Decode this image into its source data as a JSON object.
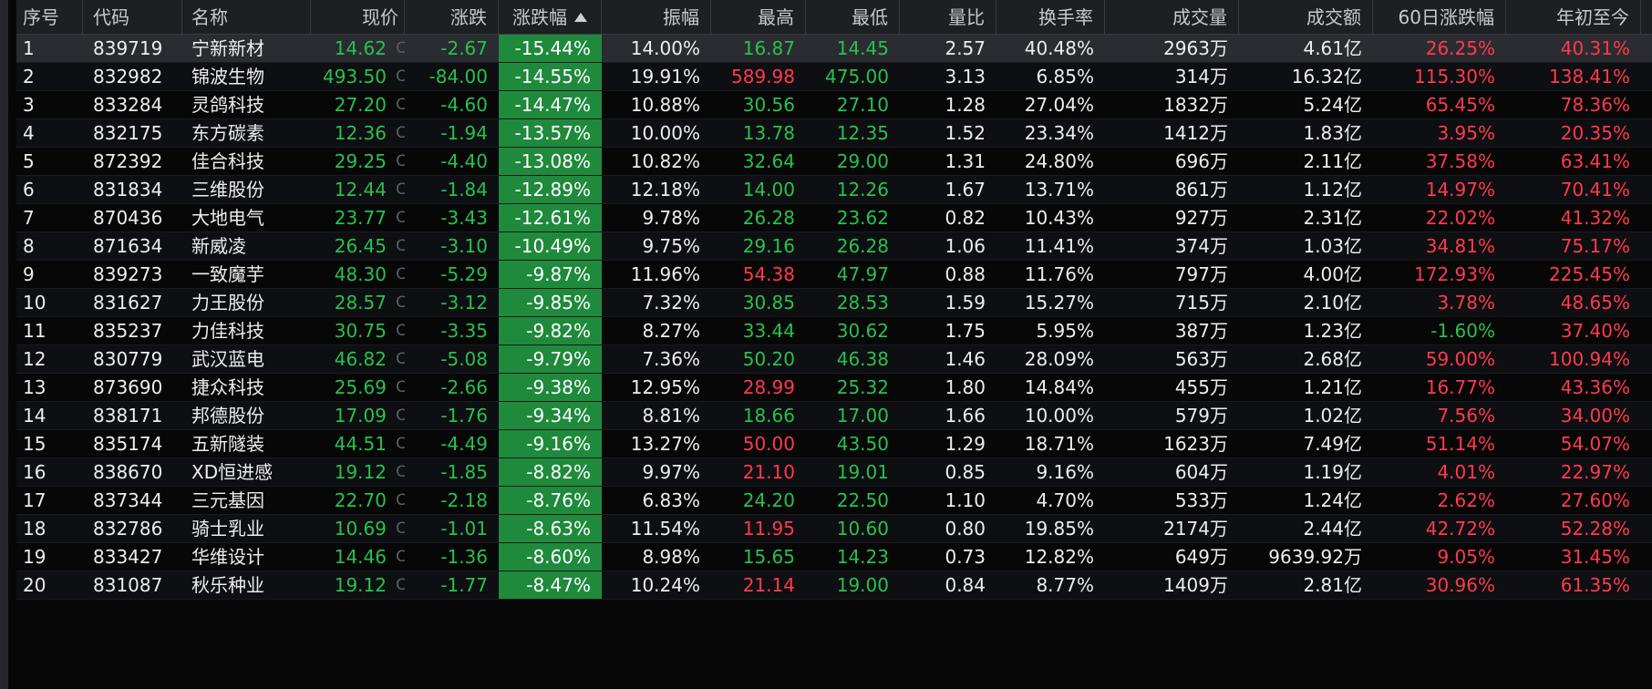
{
  "colors": {
    "up": "#ff3a4a",
    "down": "#26c24b",
    "sorted_column_bg": "#1f8a3c"
  },
  "headers": [
    "序号",
    "代码",
    "名称",
    "现价",
    "涨跌",
    "涨跌幅",
    "振幅",
    "最高",
    "最低",
    "量比",
    "换手率",
    "成交量",
    "成交额",
    "60日涨跌幅",
    "年初至今"
  ],
  "rows": [
    {
      "no": "1",
      "code": "839719",
      "name": "宁新新材",
      "price": "14.62",
      "change": "-2.67",
      "pct": "-15.44%",
      "amp": "14.00%",
      "high": "16.87",
      "high_color": "green",
      "low": "14.45",
      "low_color": "green",
      "vol_ratio": "2.57",
      "turnover": "40.48%",
      "volume": "2963万",
      "amount": "4.61亿",
      "d60": "26.25%",
      "d60_color": "red",
      "ytd": "40.31%",
      "ytd_color": "red"
    },
    {
      "no": "2",
      "code": "832982",
      "name": "锦波生物",
      "price": "493.50",
      "change": "-84.00",
      "pct": "-14.55%",
      "amp": "19.91%",
      "high": "589.98",
      "high_color": "red",
      "low": "475.00",
      "low_color": "green",
      "vol_ratio": "3.13",
      "turnover": "6.85%",
      "volume": "314万",
      "amount": "16.32亿",
      "d60": "115.30%",
      "d60_color": "red",
      "ytd": "138.41%",
      "ytd_color": "red"
    },
    {
      "no": "3",
      "code": "833284",
      "name": "灵鸽科技",
      "price": "27.20",
      "change": "-4.60",
      "pct": "-14.47%",
      "amp": "10.88%",
      "high": "30.56",
      "high_color": "green",
      "low": "27.10",
      "low_color": "green",
      "vol_ratio": "1.28",
      "turnover": "27.04%",
      "volume": "1832万",
      "amount": "5.24亿",
      "d60": "65.45%",
      "d60_color": "red",
      "ytd": "78.36%",
      "ytd_color": "red"
    },
    {
      "no": "4",
      "code": "832175",
      "name": "东方碳素",
      "price": "12.36",
      "change": "-1.94",
      "pct": "-13.57%",
      "amp": "10.00%",
      "high": "13.78",
      "high_color": "green",
      "low": "12.35",
      "low_color": "green",
      "vol_ratio": "1.52",
      "turnover": "23.34%",
      "volume": "1412万",
      "amount": "1.83亿",
      "d60": "3.95%",
      "d60_color": "red",
      "ytd": "20.35%",
      "ytd_color": "red"
    },
    {
      "no": "5",
      "code": "872392",
      "name": "佳合科技",
      "price": "29.25",
      "change": "-4.40",
      "pct": "-13.08%",
      "amp": "10.82%",
      "high": "32.64",
      "high_color": "green",
      "low": "29.00",
      "low_color": "green",
      "vol_ratio": "1.31",
      "turnover": "24.80%",
      "volume": "696万",
      "amount": "2.11亿",
      "d60": "37.58%",
      "d60_color": "red",
      "ytd": "63.41%",
      "ytd_color": "red"
    },
    {
      "no": "6",
      "code": "831834",
      "name": "三维股份",
      "price": "12.44",
      "change": "-1.84",
      "pct": "-12.89%",
      "amp": "12.18%",
      "high": "14.00",
      "high_color": "green",
      "low": "12.26",
      "low_color": "green",
      "vol_ratio": "1.67",
      "turnover": "13.71%",
      "volume": "861万",
      "amount": "1.12亿",
      "d60": "14.97%",
      "d60_color": "red",
      "ytd": "70.41%",
      "ytd_color": "red"
    },
    {
      "no": "7",
      "code": "870436",
      "name": "大地电气",
      "price": "23.77",
      "change": "-3.43",
      "pct": "-12.61%",
      "amp": "9.78%",
      "high": "26.28",
      "high_color": "green",
      "low": "23.62",
      "low_color": "green",
      "vol_ratio": "0.82",
      "turnover": "10.43%",
      "volume": "927万",
      "amount": "2.31亿",
      "d60": "22.02%",
      "d60_color": "red",
      "ytd": "41.32%",
      "ytd_color": "red"
    },
    {
      "no": "8",
      "code": "871634",
      "name": "新威凌",
      "price": "26.45",
      "change": "-3.10",
      "pct": "-10.49%",
      "amp": "9.75%",
      "high": "29.16",
      "high_color": "green",
      "low": "26.28",
      "low_color": "green",
      "vol_ratio": "1.06",
      "turnover": "11.41%",
      "volume": "374万",
      "amount": "1.03亿",
      "d60": "34.81%",
      "d60_color": "red",
      "ytd": "75.17%",
      "ytd_color": "red"
    },
    {
      "no": "9",
      "code": "839273",
      "name": "一致魔芋",
      "price": "48.30",
      "change": "-5.29",
      "pct": "-9.87%",
      "amp": "11.96%",
      "high": "54.38",
      "high_color": "red",
      "low": "47.97",
      "low_color": "green",
      "vol_ratio": "0.88",
      "turnover": "11.76%",
      "volume": "797万",
      "amount": "4.00亿",
      "d60": "172.93%",
      "d60_color": "red",
      "ytd": "225.45%",
      "ytd_color": "red"
    },
    {
      "no": "10",
      "code": "831627",
      "name": "力王股份",
      "price": "28.57",
      "change": "-3.12",
      "pct": "-9.85%",
      "amp": "7.32%",
      "high": "30.85",
      "high_color": "green",
      "low": "28.53",
      "low_color": "green",
      "vol_ratio": "1.59",
      "turnover": "15.27%",
      "volume": "715万",
      "amount": "2.10亿",
      "d60": "3.78%",
      "d60_color": "red",
      "ytd": "48.65%",
      "ytd_color": "red"
    },
    {
      "no": "11",
      "code": "835237",
      "name": "力佳科技",
      "price": "30.75",
      "change": "-3.35",
      "pct": "-9.82%",
      "amp": "8.27%",
      "high": "33.44",
      "high_color": "green",
      "low": "30.62",
      "low_color": "green",
      "vol_ratio": "1.75",
      "turnover": "5.95%",
      "volume": "387万",
      "amount": "1.23亿",
      "d60": "-1.60%",
      "d60_color": "green",
      "ytd": "37.40%",
      "ytd_color": "red"
    },
    {
      "no": "12",
      "code": "830779",
      "name": "武汉蓝电",
      "price": "46.82",
      "change": "-5.08",
      "pct": "-9.79%",
      "amp": "7.36%",
      "high": "50.20",
      "high_color": "green",
      "low": "46.38",
      "low_color": "green",
      "vol_ratio": "1.46",
      "turnover": "28.09%",
      "volume": "563万",
      "amount": "2.68亿",
      "d60": "59.00%",
      "d60_color": "red",
      "ytd": "100.94%",
      "ytd_color": "red"
    },
    {
      "no": "13",
      "code": "873690",
      "name": "捷众科技",
      "price": "25.69",
      "change": "-2.66",
      "pct": "-9.38%",
      "amp": "12.95%",
      "high": "28.99",
      "high_color": "red",
      "low": "25.32",
      "low_color": "green",
      "vol_ratio": "1.80",
      "turnover": "14.84%",
      "volume": "455万",
      "amount": "1.21亿",
      "d60": "16.77%",
      "d60_color": "red",
      "ytd": "43.36%",
      "ytd_color": "red"
    },
    {
      "no": "14",
      "code": "838171",
      "name": "邦德股份",
      "price": "17.09",
      "change": "-1.76",
      "pct": "-9.34%",
      "amp": "8.81%",
      "high": "18.66",
      "high_color": "green",
      "low": "17.00",
      "low_color": "green",
      "vol_ratio": "1.66",
      "turnover": "10.00%",
      "volume": "579万",
      "amount": "1.02亿",
      "d60": "7.56%",
      "d60_color": "red",
      "ytd": "34.00%",
      "ytd_color": "red"
    },
    {
      "no": "15",
      "code": "835174",
      "name": "五新隧装",
      "price": "44.51",
      "change": "-4.49",
      "pct": "-9.16%",
      "amp": "13.27%",
      "high": "50.00",
      "high_color": "red",
      "low": "43.50",
      "low_color": "green",
      "vol_ratio": "1.29",
      "turnover": "18.71%",
      "volume": "1623万",
      "amount": "7.49亿",
      "d60": "51.14%",
      "d60_color": "red",
      "ytd": "54.07%",
      "ytd_color": "red"
    },
    {
      "no": "16",
      "code": "838670",
      "name": "XD恒进感",
      "price": "19.12",
      "change": "-1.85",
      "pct": "-8.82%",
      "amp": "9.97%",
      "high": "21.10",
      "high_color": "red",
      "low": "19.01",
      "low_color": "green",
      "vol_ratio": "0.85",
      "turnover": "9.16%",
      "volume": "604万",
      "amount": "1.19亿",
      "d60": "4.01%",
      "d60_color": "red",
      "ytd": "22.97%",
      "ytd_color": "red"
    },
    {
      "no": "17",
      "code": "837344",
      "name": "三元基因",
      "price": "22.70",
      "change": "-2.18",
      "pct": "-8.76%",
      "amp": "6.83%",
      "high": "24.20",
      "high_color": "green",
      "low": "22.50",
      "low_color": "green",
      "vol_ratio": "1.10",
      "turnover": "4.70%",
      "volume": "533万",
      "amount": "1.24亿",
      "d60": "2.62%",
      "d60_color": "red",
      "ytd": "27.60%",
      "ytd_color": "red"
    },
    {
      "no": "18",
      "code": "832786",
      "name": "骑士乳业",
      "price": "10.69",
      "change": "-1.01",
      "pct": "-8.63%",
      "amp": "11.54%",
      "high": "11.95",
      "high_color": "red",
      "low": "10.60",
      "low_color": "green",
      "vol_ratio": "0.80",
      "turnover": "19.85%",
      "volume": "2174万",
      "amount": "2.44亿",
      "d60": "42.72%",
      "d60_color": "red",
      "ytd": "52.28%",
      "ytd_color": "red"
    },
    {
      "no": "19",
      "code": "833427",
      "name": "华维设计",
      "price": "14.46",
      "change": "-1.36",
      "pct": "-8.60%",
      "amp": "8.98%",
      "high": "15.65",
      "high_color": "green",
      "low": "14.23",
      "low_color": "green",
      "vol_ratio": "0.73",
      "turnover": "12.82%",
      "volume": "649万",
      "amount": "9639.92万",
      "d60": "9.05%",
      "d60_color": "red",
      "ytd": "31.45%",
      "ytd_color": "red"
    },
    {
      "no": "20",
      "code": "831087",
      "name": "秋乐种业",
      "price": "19.12",
      "change": "-1.77",
      "pct": "-8.47%",
      "amp": "10.24%",
      "high": "21.14",
      "high_color": "red",
      "low": "19.00",
      "low_color": "green",
      "vol_ratio": "0.84",
      "turnover": "8.77%",
      "volume": "1409万",
      "amount": "2.81亿",
      "d60": "30.96%",
      "d60_color": "red",
      "ytd": "61.35%",
      "ytd_color": "red"
    }
  ],
  "price_marker": "C"
}
